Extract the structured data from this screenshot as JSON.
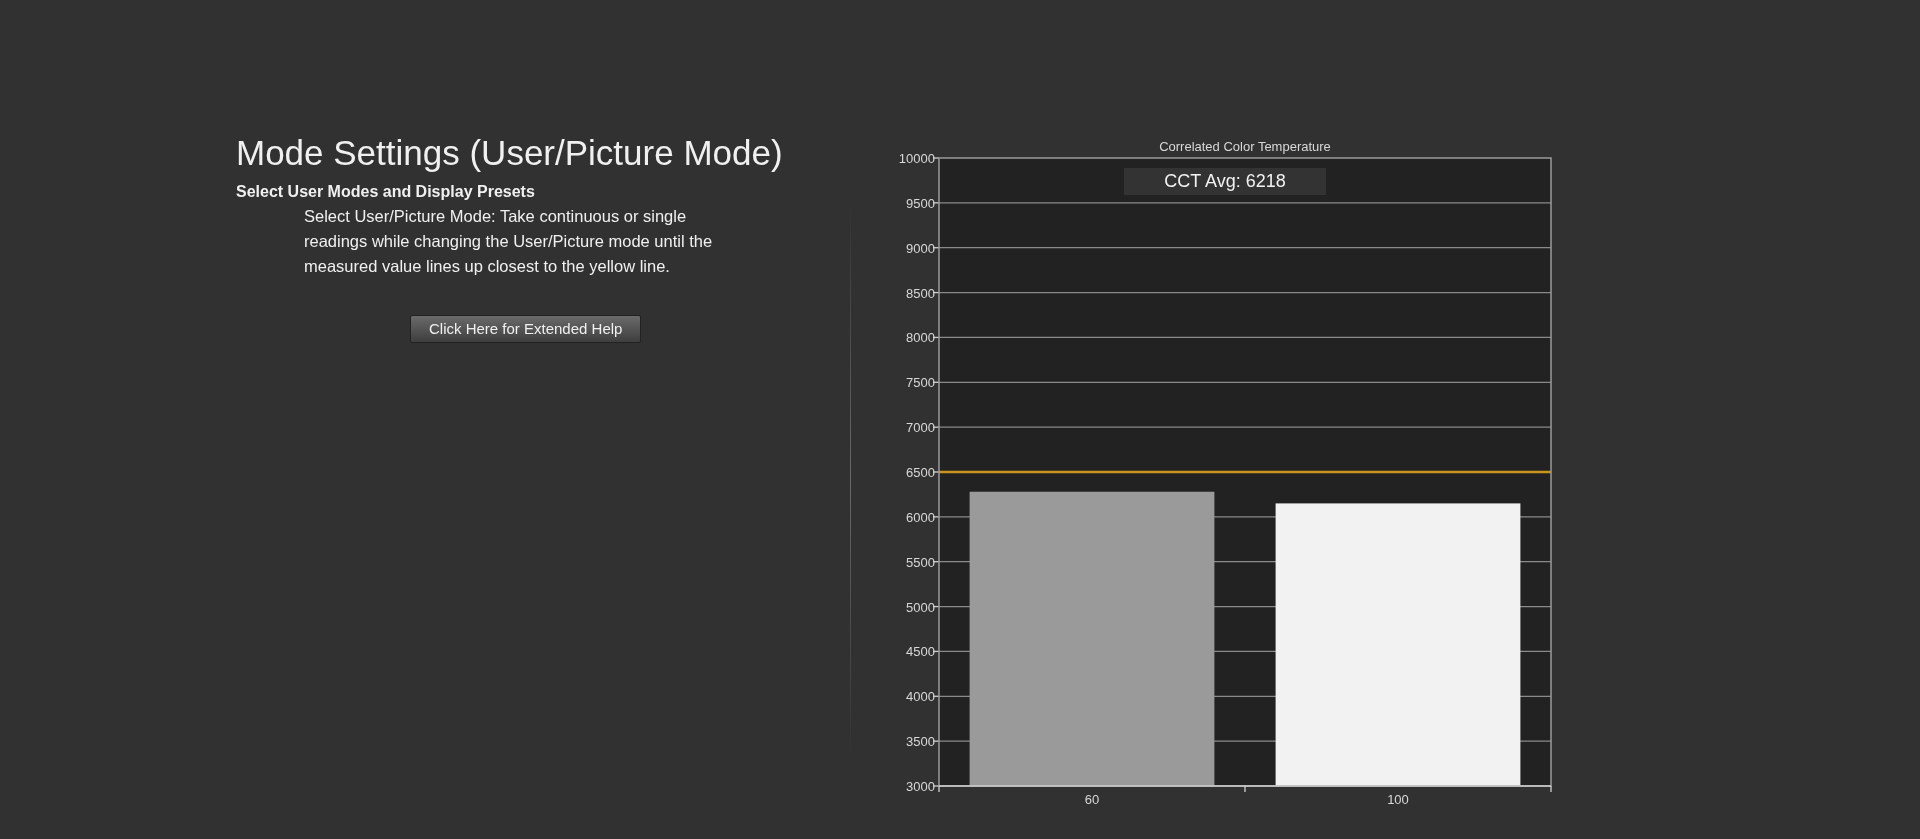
{
  "heading": {
    "title": "Mode Settings (User/Picture Mode)",
    "subtitle": "Select User Modes and Display Presets",
    "description": "Select User/Picture Mode: Take continuous or single readings while changing the User/Picture mode until the measured value lines up closest to the yellow line."
  },
  "help_button": {
    "label": "Click Here for Extended Help"
  },
  "chart": {
    "chart_data": {
      "type": "bar",
      "title": "Correlated Color Temperature",
      "categories": [
        "60",
        "100"
      ],
      "stacked": true,
      "series": [
        {
          "color": "#9a9a9a",
          "values": [
            6280,
            null
          ]
        },
        {
          "color": "#f2f2f2",
          "values": [
            null,
            6150
          ]
        }
      ],
      "grid": true,
      "ref_lines": [
        {
          "axis": "y",
          "value": 6500,
          "color": "#c8961e"
        }
      ],
      "ylim": [
        3000,
        10000
      ],
      "yticks": [
        3000,
        3500,
        4000,
        4500,
        5000,
        5500,
        6000,
        6500,
        7000,
        7500,
        8000,
        8500,
        9000,
        9500,
        10000
      ],
      "annotations": [
        {
          "text": "CCT Avg: 6218"
        }
      ]
    }
  }
}
